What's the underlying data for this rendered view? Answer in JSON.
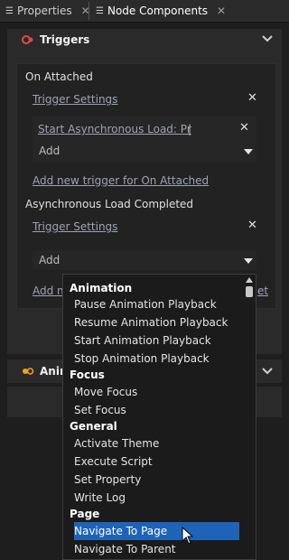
{
  "tabs": [
    {
      "label": "Properties",
      "close": "✕"
    },
    {
      "label": "Node Components",
      "close": "✕"
    }
  ],
  "triggers_section": {
    "title": "Triggers",
    "on_attached": {
      "label": "On Attached",
      "trigger_settings": "Trigger Settings",
      "action_link": "Start Asynchronous Load: Pr",
      "add_placeholder": "Add",
      "add_new_trigger": "Add new trigger for On Attached"
    },
    "async_load": {
      "label": "Asynchronous Load Completed",
      "trigger_settings": "Trigger Settings",
      "add_placeholder": "Add",
      "add_new_partial_left": "Add n",
      "add_new_partial_right": "et"
    }
  },
  "animations_section": {
    "title": "Anim"
  },
  "dropdown": {
    "groups": [
      {
        "label": "Animation",
        "items": [
          "Pause Animation Playback",
          "Resume Animation Playback",
          "Start Animation Playback",
          "Stop Animation Playback"
        ]
      },
      {
        "label": "Focus",
        "items": [
          "Move Focus",
          "Set Focus"
        ]
      },
      {
        "label": "General",
        "items": [
          "Activate Theme",
          "Execute Script",
          "Set Property",
          "Write Log"
        ]
      },
      {
        "label": "Page",
        "items": [
          "Navigate To Page",
          "Navigate To Parent"
        ]
      }
    ],
    "selected": "Navigate To Page"
  },
  "colors": {
    "accent_selection": "#1e63b8",
    "trigger_icon": "#e04a4a",
    "animation_icon": "#f0a020"
  }
}
